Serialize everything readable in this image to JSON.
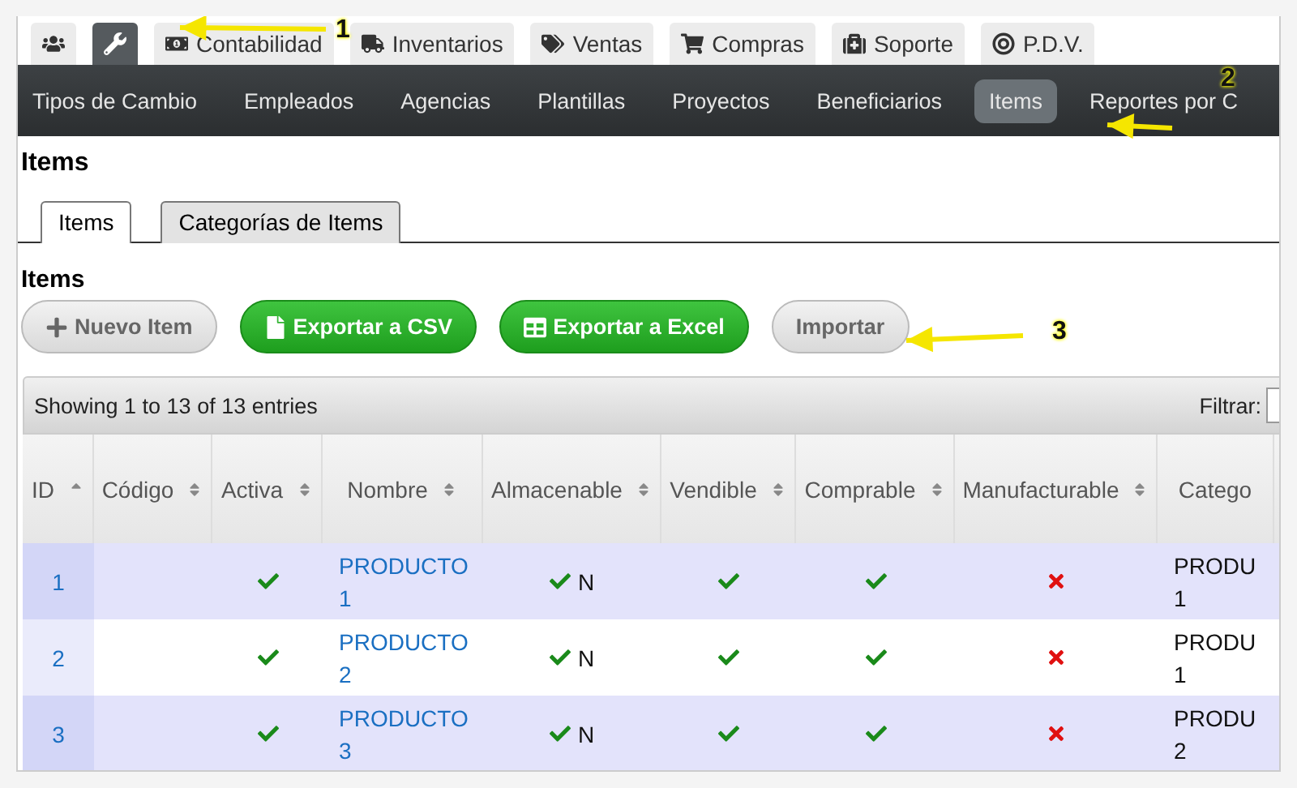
{
  "modules": [
    {
      "selected": false
    },
    {
      "selected": true
    },
    {
      "label": "Contabilidad",
      "selected": false
    },
    {
      "label": "Inventarios",
      "selected": false
    },
    {
      "label": "Ventas",
      "selected": false
    },
    {
      "label": "Compras",
      "selected": false
    },
    {
      "label": "Soporte",
      "selected": false
    },
    {
      "label": "P.D.V.",
      "selected": false
    }
  ],
  "subnav": [
    {
      "label": "Tipos de Cambio",
      "selected": false
    },
    {
      "label": "Empleados",
      "selected": false
    },
    {
      "label": "Agencias",
      "selected": false
    },
    {
      "label": "Plantillas",
      "selected": false
    },
    {
      "label": "Proyectos",
      "selected": false
    },
    {
      "label": "Beneficiarios",
      "selected": false
    },
    {
      "label": "Items",
      "selected": true
    },
    {
      "label": "Reportes por C",
      "selected": false
    }
  ],
  "page_title": "Items",
  "tabs": [
    {
      "label": "Items",
      "selected": true
    },
    {
      "label": "Categorías de Items",
      "selected": false
    }
  ],
  "section_title": "Items",
  "buttons": [
    {
      "label": "Nuevo Item",
      "kind": "default"
    },
    {
      "label": "Exportar a CSV",
      "kind": "success"
    },
    {
      "label": "Exportar a Excel",
      "kind": "success"
    },
    {
      "label": "Importar",
      "kind": "plain"
    }
  ],
  "table": {
    "info": "Showing 1 to 13 of 13 entries",
    "filter_label": "Filtrar:",
    "columns": [
      {
        "label": "ID",
        "sorted": true
      },
      {
        "label": "Código",
        "sorted": false
      },
      {
        "label": "Activa",
        "sorted": false
      },
      {
        "label": "Nombre",
        "sorted": false
      },
      {
        "label": "Almacenable",
        "sorted": false
      },
      {
        "label": "Vendible",
        "sorted": false
      },
      {
        "label": "Comprable",
        "sorted": false
      },
      {
        "label": "Manufacturable",
        "sorted": false
      },
      {
        "label": "Catego"
      }
    ],
    "rows": [
      {
        "id": "1",
        "activa": true,
        "nombre": "PRODUCTO 1",
        "almacenable": true,
        "almacenable_text": "N",
        "vendible": true,
        "comprable": true,
        "manufacturable": false,
        "categoria": "PRODU 1"
      },
      {
        "id": "2",
        "activa": true,
        "nombre": "PRODUCTO 2",
        "almacenable": true,
        "almacenable_text": "N",
        "vendible": true,
        "comprable": true,
        "manufacturable": false,
        "categoria": "PRODU 1"
      },
      {
        "id": "3",
        "activa": true,
        "nombre": "PRODUCTO 3",
        "almacenable": true,
        "almacenable_text": "N",
        "vendible": true,
        "comprable": true,
        "manufacturable": false,
        "categoria": "PRODU 2"
      }
    ]
  },
  "callouts": [
    {
      "number": "1"
    },
    {
      "number": "2"
    },
    {
      "number": "3"
    }
  ]
}
